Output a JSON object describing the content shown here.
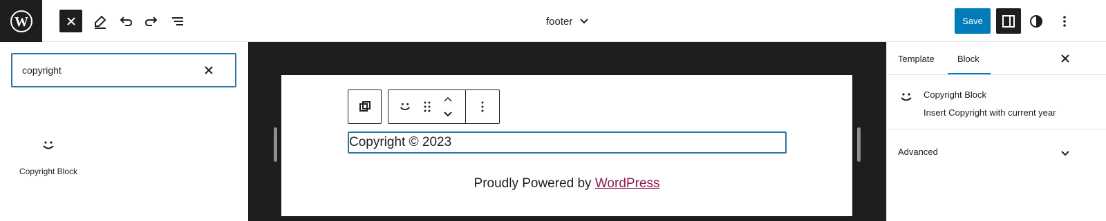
{
  "header": {
    "document_title": "footer",
    "save_label": "Save"
  },
  "inserter": {
    "search_value": "copyright",
    "results": [
      {
        "label": "Copyright Block",
        "icon": "smiley-icon"
      }
    ]
  },
  "canvas": {
    "block_text": "Copyright © 2023",
    "powered_prefix": "Proudly Powered by ",
    "powered_link": "WordPress",
    "link_color": "#8e1b4f"
  },
  "sidebar": {
    "tabs": [
      {
        "label": "Template",
        "active": false
      },
      {
        "label": "Block",
        "active": true
      }
    ],
    "block_card": {
      "title": "Copyright Block",
      "description": "Insert Copyright with current year",
      "icon": "smiley-icon"
    },
    "panels": [
      {
        "label": "Advanced",
        "expanded": false
      }
    ]
  },
  "colors": {
    "accent": "#007cba",
    "dark": "#1e1e1e"
  }
}
